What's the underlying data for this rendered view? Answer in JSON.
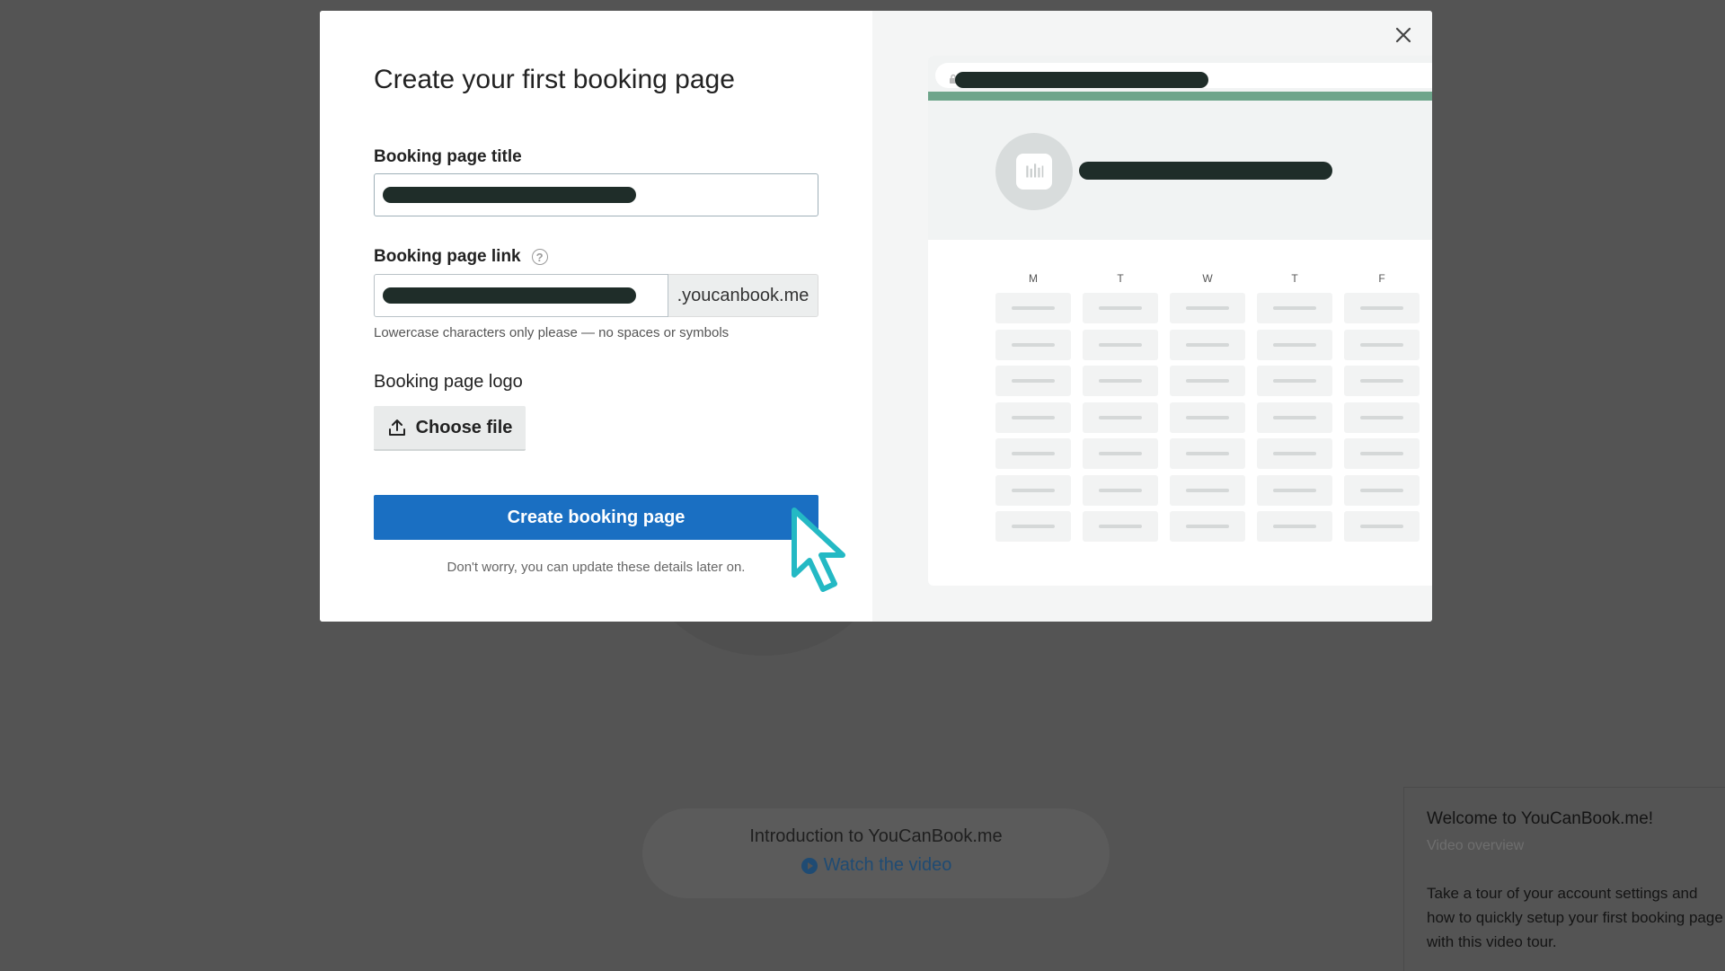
{
  "modal": {
    "title": "Create your first booking page",
    "booking_title_label": "Booking page title",
    "booking_link_label": "Booking page link",
    "link_help_icon": "question-circle-icon",
    "link_suffix": ".youcanbook.me",
    "link_hint": "Lowercase characters only please — no spaces or symbols",
    "logo_label": "Booking page logo",
    "choose_file_label": "Choose file",
    "choose_file_icon": "upload-icon",
    "create_button_label": "Create booking page",
    "note": "Don't worry, you can update these details later on.",
    "close_icon": "close-icon",
    "primary_color": "#1a6fc2"
  },
  "preview": {
    "accent_color": "#6ea58b",
    "days": [
      "M",
      "T",
      "W",
      "T",
      "F"
    ],
    "slot_rows": 7
  },
  "intro": {
    "title": "Introduction to YouCanBook.me",
    "link_label": "Watch the video",
    "link_icon": "play-circle-icon"
  },
  "welcome": {
    "title": "Welcome to YouCanBook.me!",
    "subtitle": "Video overview",
    "body": "Take a tour of your account settings and how to quickly setup your first booking page with this video tour."
  }
}
